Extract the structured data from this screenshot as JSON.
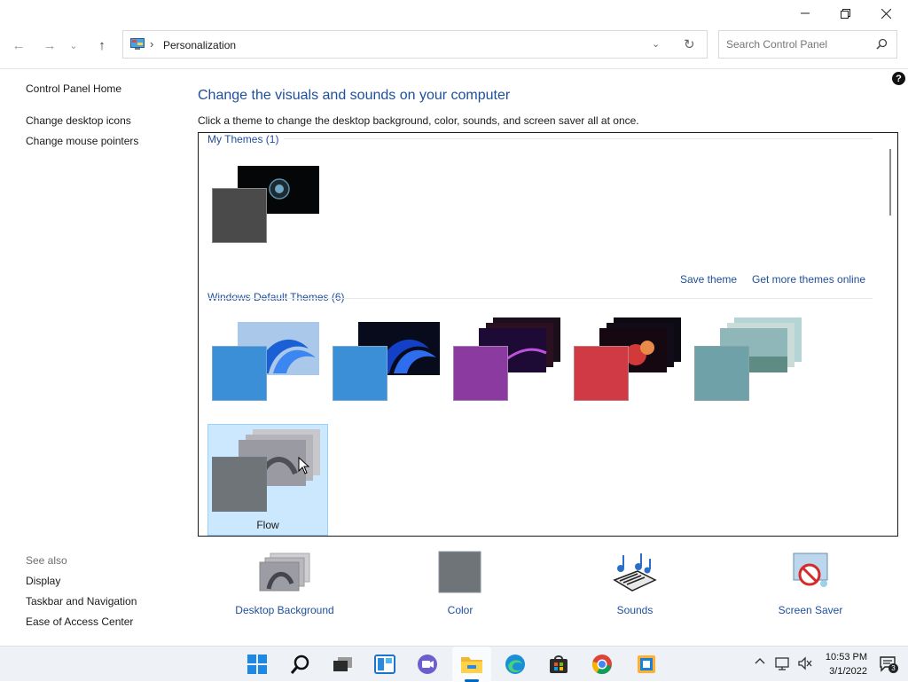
{
  "window": {
    "minimize": "—",
    "restore": "❐",
    "close": "✕"
  },
  "nav": {
    "back_icon": "←",
    "forward_icon": "→",
    "recent_icon": "⌄",
    "up_icon": "↑",
    "breadcrumb_sep": "›",
    "breadcrumb": "Personalization",
    "dropdown_icon": "⌄",
    "refresh_icon": "↻",
    "search_placeholder": "Search Control Panel",
    "help": "?"
  },
  "sidebar": {
    "home": "Control Panel Home",
    "links": [
      "Change desktop icons",
      "Change mouse pointers"
    ],
    "see_also_label": "See also",
    "see_also": [
      "Display",
      "Taskbar and Navigation",
      "Ease of Access Center"
    ]
  },
  "main": {
    "heading": "Change the visuals and sounds on your computer",
    "subtext": "Click a theme to change the desktop background, color, sounds, and screen saver all at once.",
    "my_themes_label": "My Themes (1)",
    "save_theme": "Save theme",
    "get_more": "Get more themes online",
    "default_themes_label": "Windows Default Themes (6)",
    "selected_theme": "Flow"
  },
  "settings": [
    {
      "label": "Desktop Background"
    },
    {
      "label": "Color"
    },
    {
      "label": "Sounds"
    },
    {
      "label": "Screen Saver"
    }
  ],
  "taskbar": {
    "time": "10:53 PM",
    "date": "3/1/2022",
    "chevron": "^",
    "notif_count": "3"
  },
  "colors": {
    "link": "#1f4e9b",
    "selected_bg": "#cce8ff",
    "accent": "#0067c0"
  }
}
